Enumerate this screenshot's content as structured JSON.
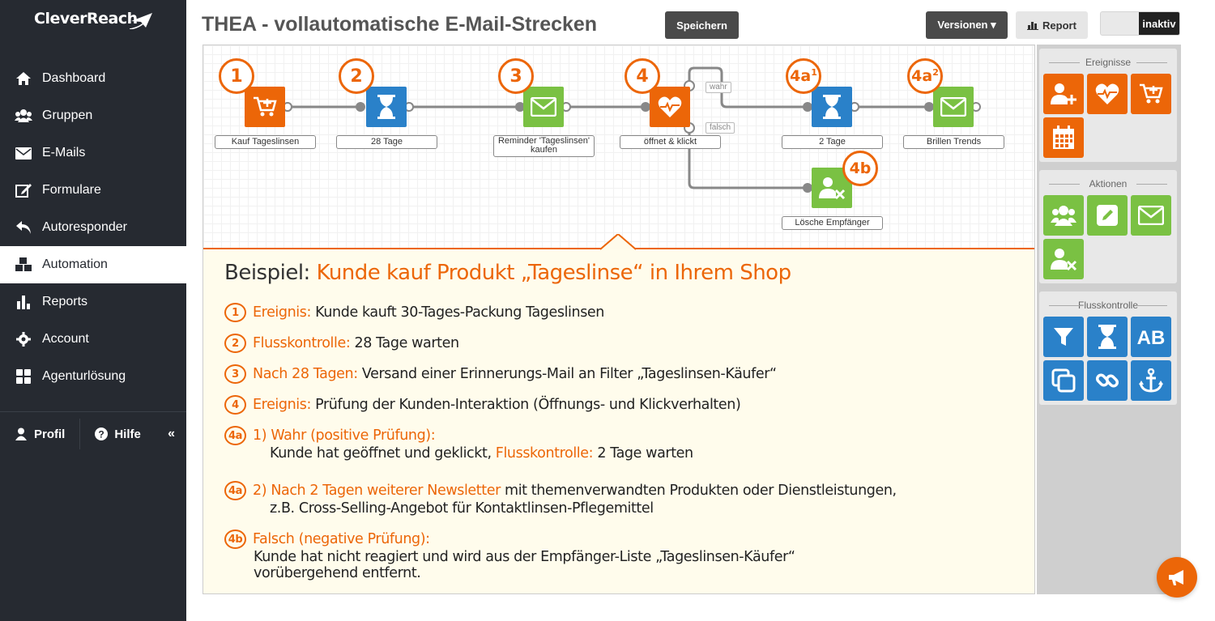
{
  "brand": "CleverReach",
  "sidebar": {
    "items": [
      {
        "label": "Dashboard",
        "icon": "home-icon"
      },
      {
        "label": "Gruppen",
        "icon": "users-icon"
      },
      {
        "label": "E-Mails",
        "icon": "envelope-icon"
      },
      {
        "label": "Formulare",
        "icon": "edit-icon"
      },
      {
        "label": "Autoresponder",
        "icon": "reply-icon"
      },
      {
        "label": "Automation",
        "icon": "cubes-icon",
        "active": true
      },
      {
        "label": "Reports",
        "icon": "bar-chart-icon"
      },
      {
        "label": "Account",
        "icon": "gear-icon"
      },
      {
        "label": "Agenturlösung",
        "icon": "grid-icon"
      }
    ],
    "profile": "Profil",
    "help": "Hilfe",
    "collapse": "«"
  },
  "header": {
    "title": "THEA - vollautomatische E-Mail-Strecken",
    "save": "Speichern",
    "versions": "Versionen ▾",
    "report": "Report",
    "status": "inaktiv"
  },
  "flow": {
    "nodes": [
      {
        "label": "Kauf Tageslinsen",
        "badge": "1"
      },
      {
        "label": "28 Tage",
        "badge": "2"
      },
      {
        "label": "Reminder 'Tageslinsen' kaufen",
        "badge": "3"
      },
      {
        "label": "öffnet & klickt",
        "badge": "4"
      },
      {
        "label": "2 Tage",
        "badge": "4a",
        "sup": "1"
      },
      {
        "label": "Brillen Trends",
        "badge": "4a",
        "sup": "2"
      },
      {
        "label": "Lösche Empfänger",
        "badge": "4b"
      }
    ],
    "true_tag": "wahr",
    "false_tag": "falsch"
  },
  "info": {
    "title_prefix": "Beispiel:",
    "title_highlight": "Kunde kauf Produkt „Tageslinse“ in Ihrem Shop",
    "rows": [
      {
        "num": "1",
        "key": "Ereignis:",
        "text": "Kunde kauft 30-Tages-Packung Tageslinsen"
      },
      {
        "num": "2",
        "key": "Flusskontrolle:",
        "text": "28 Tage warten"
      },
      {
        "num": "3",
        "key": "Nach 28 Tagen:",
        "text": "Versand einer Erinnerungs-Mail an Filter „Tageslinsen-Käufer“"
      },
      {
        "num": "4",
        "key": "Ereignis:",
        "text": "Prüfung der Kunden-Interaktion (Öffnungs- und Klickverhalten)"
      },
      {
        "num": "4a",
        "key": "1) Wahr (positive Prüfung):",
        "line2a": "Kunde hat geöffnet und geklickt,",
        "line2key": "Flusskontrolle:",
        "line2b": "2 Tage warten"
      },
      {
        "num": "4a",
        "key": "2) Nach 2 Tagen weiterer Newsletter",
        "text": "mit themenverwandten Produkten oder Dienstleistungen,",
        "line2": "z.B. Cross-Selling-Angebot für Kontaktlinsen-Pflegemittel"
      },
      {
        "num": "4b",
        "key": "Falsch (negative Prüfung):",
        "line2": "Kunde hat nicht reagiert und wird aus der Empfänger-Liste  „Tageslinsen-Käufer“",
        "line3": "vorübergehend entfernt."
      }
    ]
  },
  "panel": {
    "events": "Ereignisse",
    "actions": "Aktionen",
    "flow_control": "Flusskontrolle"
  },
  "colors": {
    "orange": "#ec6608",
    "blue": "#2a81c9",
    "green": "#7ac143",
    "sidebar": "#262a31"
  }
}
